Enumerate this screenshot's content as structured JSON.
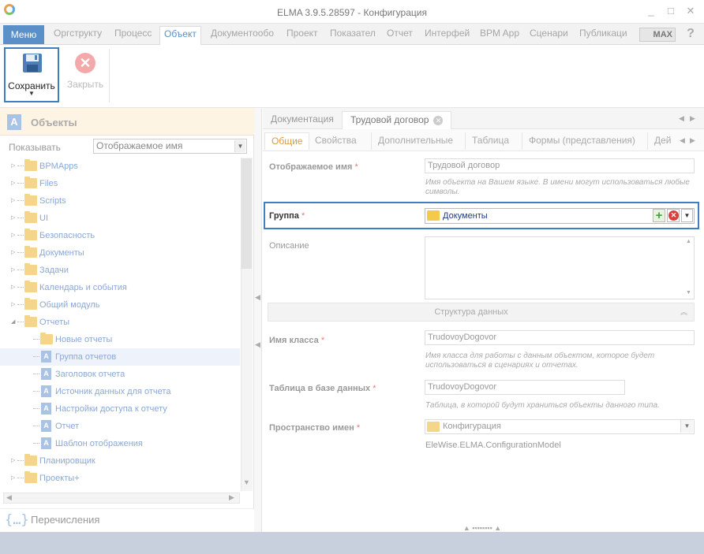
{
  "window": {
    "title": "ELMA 3.9.5.28597 - Конфигурация",
    "controls": [
      "_",
      "□",
      "✕"
    ]
  },
  "menubar": {
    "menu_label": "Меню",
    "tabs": [
      "Оргструкту",
      "Процесс",
      "Объект",
      "Документообо",
      "Проект",
      "Показател",
      "Отчет",
      "Интерфей",
      "BPM App",
      "Сценари",
      "Публикаци"
    ],
    "active_tab": "Объект",
    "max_label": "MAX",
    "help_label": "?"
  },
  "toolbar": {
    "save_label": "Сохранить",
    "close_label": "Закрыть"
  },
  "left": {
    "header_title": "Объекты",
    "show_label": "Показывать",
    "show_value": "Отображаемое имя",
    "tree": [
      {
        "label": "BPMApps",
        "type": "folder",
        "level": 0,
        "expand": "▷"
      },
      {
        "label": "Files",
        "type": "folder",
        "level": 0,
        "expand": "▷"
      },
      {
        "label": "Scripts",
        "type": "folder",
        "level": 0,
        "expand": "▷"
      },
      {
        "label": "UI",
        "type": "folder",
        "level": 0,
        "expand": "▷"
      },
      {
        "label": "Безопасность",
        "type": "folder",
        "level": 0,
        "expand": "▷"
      },
      {
        "label": "Документы",
        "type": "folder",
        "level": 0,
        "expand": "▷"
      },
      {
        "label": "Задачи",
        "type": "folder",
        "level": 0,
        "expand": "▷"
      },
      {
        "label": "Календарь и события",
        "type": "folder",
        "level": 0,
        "expand": "▷"
      },
      {
        "label": "Общий модуль",
        "type": "folder",
        "level": 0,
        "expand": "▷"
      },
      {
        "label": "Отчеты",
        "type": "folder",
        "level": 0,
        "expand": "◢"
      },
      {
        "label": "Новые отчеты",
        "type": "folder",
        "level": 1,
        "expand": ""
      },
      {
        "label": "Группа отчетов",
        "type": "class",
        "level": 1,
        "expand": "",
        "selected": true
      },
      {
        "label": "Заголовок отчета",
        "type": "class",
        "level": 1,
        "expand": ""
      },
      {
        "label": "Источник данных для отчета",
        "type": "class",
        "level": 1,
        "expand": ""
      },
      {
        "label": "Настройки доступа к отчету",
        "type": "class",
        "level": 1,
        "expand": ""
      },
      {
        "label": "Отчет",
        "type": "class",
        "level": 1,
        "expand": ""
      },
      {
        "label": "Шаблон отображения",
        "type": "class",
        "level": 1,
        "expand": ""
      },
      {
        "label": "Планировщик",
        "type": "folder",
        "level": 0,
        "expand": "▷"
      },
      {
        "label": "Проекты+",
        "type": "folder",
        "level": 0,
        "expand": "▷"
      }
    ],
    "enum_label": "Перечисления"
  },
  "doc_tabs": [
    {
      "label": "Документация"
    },
    {
      "label": "Трудовой договор",
      "active": true
    }
  ],
  "prop_tabs": [
    "Общие",
    "Свойства",
    "Дополнительные",
    "Таблица",
    "Формы (представления)",
    "Дей"
  ],
  "form": {
    "display_name_label": "Отображаемое имя",
    "display_name_value": "Трудовой договор",
    "display_name_hint": "Имя объекта на Вашем языке. В имени могут использоваться любые символы.",
    "group_label": "Группа",
    "group_value": "Документы",
    "description_label": "Описание",
    "structure_label": "Структура данных",
    "class_name_label": "Имя класса",
    "class_name_value": "TrudovoyDogovor",
    "class_name_hint": "Имя класса для работы с данным объектом, которое будет использоваться в сценариях и отчетах.",
    "table_label": "Таблица в базе данных",
    "table_value": "TrudovoyDogovor",
    "table_hint": "Таблица, в которой будут храниться объекты данного типа.",
    "namespace_label": "Пространство имен",
    "namespace_value": "Конфигурация",
    "namespace_full": "EleWise.ELMA.ConfigurationModel",
    "required_mark": "*"
  }
}
